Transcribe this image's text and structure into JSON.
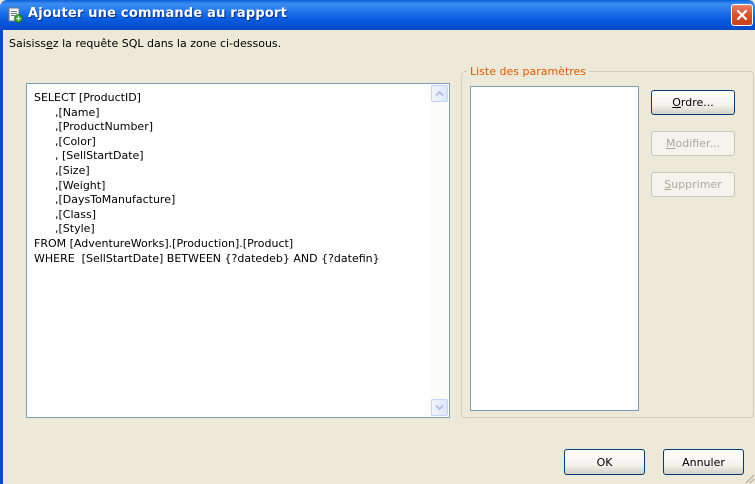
{
  "window": {
    "title": "Ajouter une commande au rapport"
  },
  "instruction": {
    "before": "Saisiss",
    "mnemonic": "e",
    "after": "z la requête SQL dans la zone ci-dessous."
  },
  "sql_query": "SELECT [ProductID]\n      ,[Name]\n      ,[ProductNumber]\n      ,[Color]\n      , [SellStartDate]\n      ,[Size]\n      ,[Weight]\n      ,[DaysToManufacture]\n      ,[Class]\n      ,[Style]\nFROM [AdventureWorks].[Production].[Product]\nWHERE  [SellStartDate] BETWEEN {?datedeb} AND {?datefin}",
  "parameters": {
    "group_label": "Liste des paramètres",
    "items": []
  },
  "buttons": {
    "ordre": {
      "mnemonic": "O",
      "rest": "rdre...",
      "enabled": true
    },
    "modifier": {
      "mnemonic": "M",
      "rest": "odifier...",
      "enabled": false
    },
    "supprimer": {
      "mnemonic": "S",
      "rest": "upprimer",
      "enabled": false
    },
    "ok": "OK",
    "annuler": "Annuler"
  },
  "colors": {
    "titlebar": "#0c5ee0",
    "dialog_bg": "#ece9d8",
    "group_label": "#e05a00",
    "close_button": "#d9542c"
  },
  "icons": {
    "title": "report-add-icon",
    "close": "close-icon",
    "scroll_up": "chevron-up-icon",
    "scroll_down": "chevron-down-icon"
  }
}
